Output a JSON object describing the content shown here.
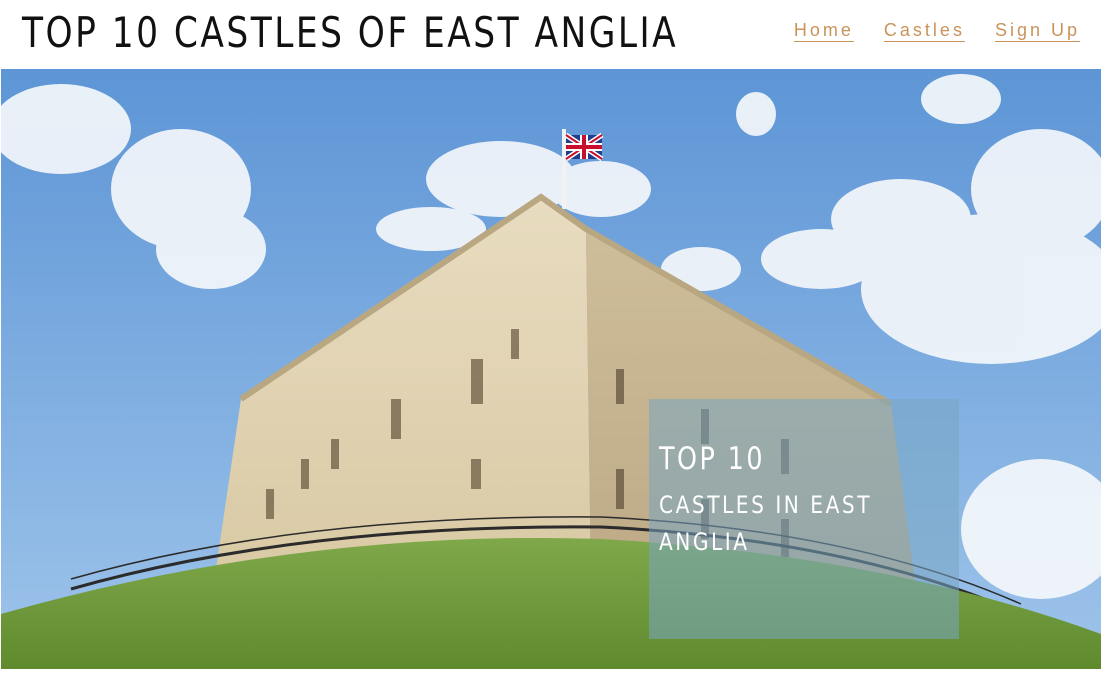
{
  "header": {
    "site_title": "TOP 10 CASTLES OF EAST ANGLIA",
    "nav": [
      {
        "label": "Home"
      },
      {
        "label": "Castles"
      },
      {
        "label": "Sign Up"
      }
    ]
  },
  "hero": {
    "caption_line1": "TOP 10",
    "caption_line2": "CASTLES IN EAST ANGLIA"
  },
  "colors": {
    "nav_link": "#c9935a",
    "title": "#111111",
    "caption_box": "rgba(120,165,195,0.55)"
  }
}
